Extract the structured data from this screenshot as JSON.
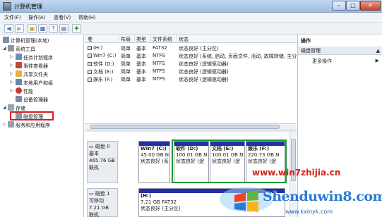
{
  "window": {
    "title": "计算机管理",
    "controls": {
      "min": "–",
      "max": "□",
      "close": "✕"
    }
  },
  "menu": [
    "文件(F)",
    "操作(A)",
    "查看(V)",
    "帮助(H)"
  ],
  "toolbar": [
    "back-icon",
    "forward-icon",
    "up-folder-icon",
    "show-tree-icon",
    "help-icon",
    "properties-icon",
    "refresh-icon"
  ],
  "tree": {
    "root": "计算机管理(本地)",
    "system_tools": "系统工具",
    "items": [
      "任务计划程序",
      "事件查看器",
      "共享文件夹",
      "本地用户和组",
      "性能",
      "设备管理器"
    ],
    "storage": "存储",
    "disk_mgmt": "磁盘管理",
    "services": "服务和应用程序"
  },
  "grid": {
    "columns": [
      "卷",
      "布局",
      "类型",
      "文件系统",
      "状态"
    ],
    "rows": [
      [
        "(H:)",
        "简单",
        "基本",
        "FAT32",
        "状态良好 (主分区)"
      ],
      [
        "Win7 (C:)",
        "简单",
        "基本",
        "NTFS",
        "状态良好 (系统, 启动, 页面文件, 活动, 故障转储, 主分区)"
      ],
      [
        "软件 (D:)",
        "简单",
        "基本",
        "NTFS",
        "状态良好 (逻辑驱动器)"
      ],
      [
        "文档 (E:)",
        "简单",
        "基本",
        "NTFS",
        "状态良好 (逻辑驱动器)"
      ],
      [
        "娱乐 (F:)",
        "简单",
        "基本",
        "NTFS",
        "状态良好 (逻辑驱动器)"
      ]
    ]
  },
  "disks": [
    {
      "name": "磁盘 0",
      "type": "基本",
      "size": "465.76 GB",
      "status": "联机",
      "partitions": [
        {
          "name": "Win7  (C:)",
          "size": "45.00 GB N",
          "status": "状态良好 (系"
        },
        {
          "name": "软件  (D:)",
          "size": "100.01 GB N",
          "status": "状态良好 (逻"
        },
        {
          "name": "文档  (E:)",
          "size": "100.01 GB N",
          "status": "状态良好 (逻"
        },
        {
          "name": "娱乐  (F:)",
          "size": "220.73 GB N",
          "status": "状态良好 (逻"
        }
      ]
    },
    {
      "name": "磁盘 1",
      "type": "可移动",
      "size": "7.21 GB",
      "status": "联机",
      "partitions": [
        {
          "name": "(H:)",
          "size": "7.21 GB FAT32",
          "status": "状态良好 (主分区)"
        }
      ]
    }
  ],
  "actions": {
    "header": "操作",
    "section": "磁盘管理",
    "more": "更多操作"
  },
  "watermark": {
    "url": "www.win7zhijia.cn",
    "brand": "Shenduwin8.com",
    "sub": "www.kxinyk.com"
  },
  "colors": {
    "partition_cap": "#1f2fa6",
    "highlight_red": "#e0161f",
    "highlight_green": "#1c9a34"
  }
}
